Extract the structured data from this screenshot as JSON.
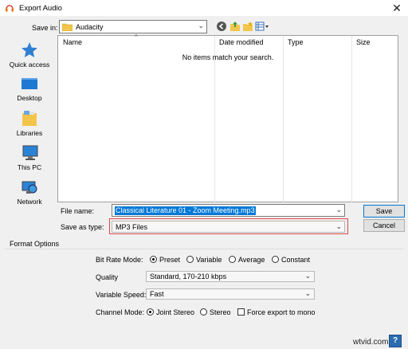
{
  "window": {
    "title": "Export Audio"
  },
  "save_in": {
    "label": "Save in:",
    "value": "Audacity"
  },
  "places": [
    {
      "name": "quick-access",
      "label": "Quick access"
    },
    {
      "name": "desktop",
      "label": "Desktop"
    },
    {
      "name": "libraries",
      "label": "Libraries"
    },
    {
      "name": "this-pc",
      "label": "This PC"
    },
    {
      "name": "network",
      "label": "Network"
    }
  ],
  "file_list": {
    "columns": [
      "Name",
      "Date modified",
      "Type",
      "Size"
    ],
    "empty_message": "No items match your search."
  },
  "file_name": {
    "label": "File name:",
    "value": "Classical Literature 01 - Zoom Meeting.mp3"
  },
  "save_as_type": {
    "label": "Save as type:",
    "value": "MP3 Files"
  },
  "buttons": {
    "save": "Save",
    "cancel": "Cancel"
  },
  "format_options": {
    "title": "Format Options",
    "bit_rate_mode": {
      "label": "Bit Rate Mode:",
      "options": [
        "Preset",
        "Variable",
        "Average",
        "Constant"
      ],
      "selected": "Preset"
    },
    "quality": {
      "label": "Quality",
      "value": "Standard, 170-210 kbps"
    },
    "variable_speed": {
      "label": "Variable Speed:",
      "value": "Fast"
    },
    "channel_mode": {
      "label": "Channel Mode:",
      "options": [
        "Joint Stereo",
        "Stereo"
      ],
      "selected": "Joint Stereo",
      "force_mono_label": "Force export to mono",
      "force_mono_checked": false
    }
  },
  "help": {
    "label": "?"
  },
  "watermark": "wtvid.com",
  "colors": {
    "accent": "#0078d7",
    "highlight_frame": "#e0484a",
    "background": "#f0f0f0"
  }
}
